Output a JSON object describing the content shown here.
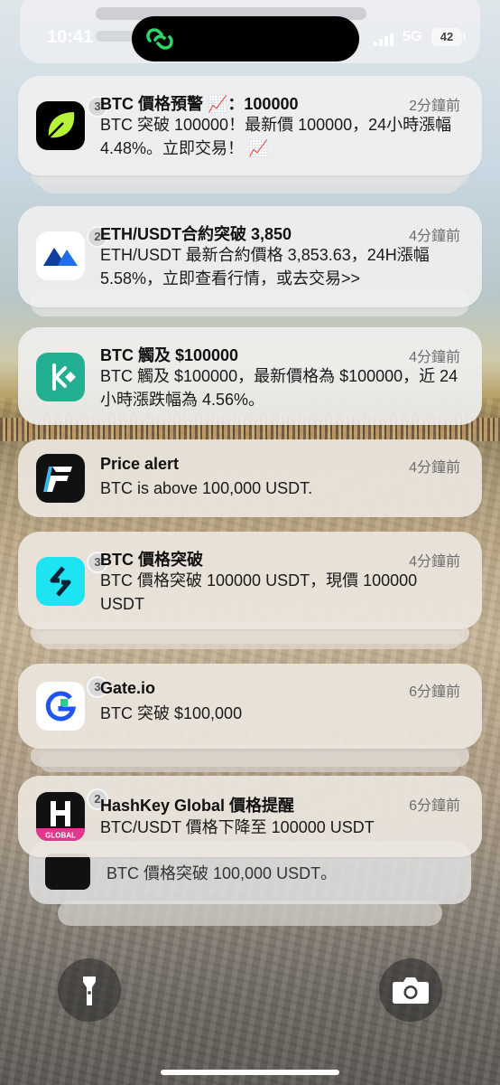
{
  "status_bar": {
    "time": "10:41",
    "network": "5G",
    "battery": "42"
  },
  "notifications": [
    {
      "app_icon": "leaf-app-icon",
      "badge": "3",
      "title": "BTC 價格預警 📈：100000",
      "time": "2分鐘前",
      "body": "BTC 突破 100000！最新價 100000，24小時漲幅 4.48%。立即交易！ 📈"
    },
    {
      "app_icon": "mountain-app-icon",
      "badge": "2",
      "title": "ETH/USDT合約突破 3,850",
      "time": "4分鐘前",
      "body": "ETH/USDT 最新合約價格 3,853.63，24H漲幅 5.58%，立即查看行情，或去交易>>"
    },
    {
      "app_icon": "kucoin-app-icon",
      "badge": "",
      "title": "BTC 觸及 $100000",
      "time": "4分鐘前",
      "body": "BTC 觸及 $100000，最新價格為 $100000，近 24 小時漲跌幅為 4.56%。"
    },
    {
      "app_icon": "flash-app-icon",
      "badge": "",
      "title": "Price alert",
      "time": "4分鐘前",
      "body": "BTC is above 100,000 USDT."
    },
    {
      "app_icon": "bitget-app-icon",
      "badge": "3",
      "title": "BTC 價格突破",
      "time": "4分鐘前",
      "body": "BTC 價格突破 100000 USDT，現價 100000 USDT"
    },
    {
      "app_icon": "gate-app-icon",
      "badge": "3",
      "title": "Gate.io",
      "time": "6分鐘前",
      "body": "BTC 突破 $100,000"
    },
    {
      "app_icon": "hashkey-app-icon",
      "badge": "2",
      "title": "HashKey Global 價格提醒",
      "time": "6分鐘前",
      "body": "BTC/USDT 價格下降至 100000 USDT",
      "icon_label": "GLOBAL"
    }
  ],
  "behind_notification": {
    "body": "BTC 價格突破 100,000 USDT。"
  },
  "controls": {
    "flashlight": "flashlight-icon",
    "camera": "camera-icon"
  }
}
